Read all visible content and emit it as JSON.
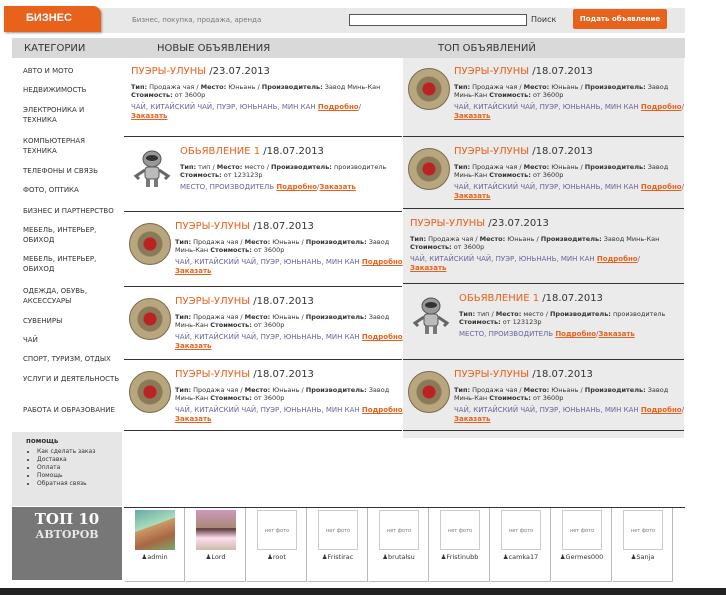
{
  "header": {
    "logo": "БИЗНЕС",
    "tagline": "Бизнес, покупка, продажа, аренда",
    "search_label": "Поиск",
    "add_button": "Подать объявление"
  },
  "bar": {
    "categories": "Категории",
    "new_ads": "Новые объявления",
    "top_ads": "Топ объявлений"
  },
  "categories": [
    "АВТО И МОТО",
    "НЕДВИЖИМОСТЬ",
    "ЭЛЕКТРОНИКА И ТЕХНИКА",
    "КОМПЬЮТЕРНАЯ ТЕХНИКА",
    "ТЕЛЕФОНЫ И СВЯЗЬ",
    "ФОТО, ОПТИКА",
    "БИЗНЕС И ПАРТНЕРСТВО",
    "МЕБЕЛЬ, ИНТЕРЬЕР, ОБИХОД",
    "МЕБЕЛЬ, ИНТЕРЬЕР, ОБИХОД",
    "ОДЕЖДА, ОБУВЬ, АКСЕССУАРЫ",
    "СУВЕНИРЫ",
    "ЧАЙ",
    "СПОРТ, ТУРИЗМ, ОТДЫХ",
    "УСЛУГИ И ДЕЯТЕЛЬНОСТЬ",
    "РАБОТА И ОБРАЗОВАНИЕ"
  ],
  "help": {
    "title": "помощь",
    "items": [
      "Как сделать заказ",
      "Доставка",
      "Оплата",
      "Помощь",
      "Обратная связь"
    ]
  },
  "top10": {
    "line1": "ТОП 10",
    "line2": "АВТОРОВ"
  },
  "labels": {
    "type": "Тип:",
    "place": "Место:",
    "producer": "Производитель:",
    "cost": "Стоимость:",
    "more": "Подробно",
    "order": "Заказать",
    "sep": " / "
  },
  "ads_new": [
    {
      "name": "ПУЭРЫ-УЛУНЫ",
      "date": " /23.07.2013",
      "type": "Продажа чая",
      "place": "Юньань",
      "producer": "Завод Минь-Кан",
      "cost": "от 3600р",
      "tags": "ЧАЙ, КИТАЙСКИЙ ЧАЙ, ПУЭР, ЮНЬНАНЬ, МИН КАН"
    },
    {
      "name": "ОБЬЯВЛЕНИЕ 1",
      "date": " /18.07.2013",
      "type": "тип",
      "place": "место",
      "producer": "производитель",
      "cost": "от 123123р",
      "tags": "МЕСТО, ПРОИЗВОДИТЕЛЬ"
    },
    {
      "name": "ПУЭРЫ-УЛУНЫ",
      "date": " /18.07.2013",
      "type": "Продажа чая",
      "place": "Юньань",
      "producer": "Завод Минь-Кан",
      "cost": "от 3600р",
      "tags": "ЧАЙ, КИТАЙСКИЙ ЧАЙ, ПУЭР, ЮНЬНАНЬ, МИН КАН"
    },
    {
      "name": "ПУЭРЫ-УЛУНЫ",
      "date": " /18.07.2013",
      "type": "Продажа чая",
      "place": "Юньань",
      "producer": "Завод Минь-Кан",
      "cost": "от 3600р",
      "tags": "ЧАЙ, КИТАЙСКИЙ ЧАЙ, ПУЭР, ЮНЬНАНЬ, МИН КАН"
    },
    {
      "name": "ПУЭРЫ-УЛУНЫ",
      "date": " /18.07.2013",
      "type": "Продажа чая",
      "place": "Юньань",
      "producer": "Завод Минь-Кан",
      "cost": "от 3600р",
      "tags": "ЧАЙ, КИТАЙСКИЙ ЧАЙ, ПУЭР, ЮНЬНАНЬ, МИН КАН"
    }
  ],
  "ads_top": [
    {
      "name": "ПУЭРЫ-УЛУНЫ",
      "date": " /18.07.2013",
      "type": "Продажа чая",
      "place": "Юньань",
      "producer": "Завод Минь-Кан",
      "cost": "от 3600р",
      "tags": "ЧАЙ, КИТАЙСКИЙ ЧАЙ, ПУЭР, ЮНЬНАНЬ, МИН КАН"
    },
    {
      "name": "ПУЭРЫ-УЛУНЫ",
      "date": " /18.07.2013",
      "type": "Продажа чая",
      "place": "Юньань",
      "producer": "Завод Минь-Кан",
      "cost": "от 3600р",
      "tags": "ЧАЙ, КИТАЙСКИЙ ЧАЙ, ПУЭР, ЮНЬНАНЬ, МИН КАН"
    },
    {
      "name": "ПУЭРЫ-УЛУНЫ",
      "date": " /23.07.2013",
      "type": "Продажа чая",
      "place": "Юньань",
      "producer": "Завод Минь-Кан",
      "cost": "от 3600р",
      "tags": "ЧАЙ, КИТАЙСКИЙ ЧАЙ, ПУЭР, ЮНЬНАНЬ, МИН КАН"
    },
    {
      "name": "ОБЬЯВЛЕНИЕ 1",
      "date": " /18.07.2013",
      "type": "тип",
      "place": "место",
      "producer": "производитель",
      "cost": "от 123123р",
      "tags": "МЕСТО, ПРОИЗВОДИТЕЛЬ"
    },
    {
      "name": "ПУЭРЫ-УЛУНЫ",
      "date": " /18.07.2013",
      "type": "Продажа чая",
      "place": "Юньань",
      "producer": "Завод Минь-Кан",
      "cost": "от 3600р",
      "tags": "ЧАЙ, КИТАЙСКИЙ ЧАЙ, ПУЭР, ЮНЬНАНЬ, МИН КАН"
    }
  ],
  "authors": [
    {
      "name": "admin",
      "photo": ""
    },
    {
      "name": "Lord",
      "photo": ""
    },
    {
      "name": "root",
      "photo": "нет фото"
    },
    {
      "name": "Fristirac",
      "photo": "нет фото"
    },
    {
      "name": "brutalsu",
      "photo": "нет фото"
    },
    {
      "name": "Fristinubb",
      "photo": "нет фото"
    },
    {
      "name": "camka17",
      "photo": "нет фото"
    },
    {
      "name": "Germes000",
      "photo": "нет фото"
    },
    {
      "name": "Sanja",
      "photo": "нет фото"
    }
  ],
  "colors": {
    "accent": "#e8621c",
    "bar": "#d9d9d9",
    "sidebar_dark": "#777777"
  }
}
